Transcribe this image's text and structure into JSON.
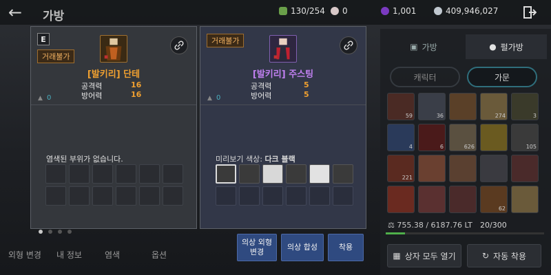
{
  "window": {
    "title": "가방"
  },
  "currencies": [
    {
      "icon": "inventory-capacity-icon",
      "value": "130/254",
      "color": "#6aa04a"
    },
    {
      "icon": "pearl-icon",
      "value": "0",
      "color": "#d8c8c8"
    },
    {
      "icon": "purple-gem-icon",
      "value": "1,001",
      "color": "#7a3ac0"
    },
    {
      "icon": "silver-coin-icon",
      "value": "409,946,027",
      "color": "#c0c8d0"
    }
  ],
  "right_panel": {
    "tabs": [
      {
        "label": "가방",
        "active": false
      },
      {
        "label": "펄가방",
        "active": true
      }
    ],
    "subtabs": [
      {
        "label": "캐릭터",
        "active": false
      },
      {
        "label": "가문",
        "active": true
      }
    ],
    "grid_counts": [
      "59",
      "36",
      "",
      "274",
      "3",
      "4",
      "6",
      "626",
      "",
      "105",
      "221",
      "",
      "",
      "",
      "",
      "",
      "",
      "",
      "62",
      ""
    ],
    "weight": "755.38 / 6187.76 LT",
    "weight_fraction": 0.12,
    "slots": "20/300",
    "open_all_button": "상자 모두 열기",
    "auto_arrange_button": "자동 착용"
  },
  "bottom_tabs": [
    "외형 변경",
    "내 정보",
    "염색",
    "옵션"
  ],
  "left_item": {
    "grade": "E",
    "trade_tag": "거래불가",
    "name": "[발키리] 단테",
    "stats": [
      {
        "label": "공격력",
        "value": "16"
      },
      {
        "label": "방어력",
        "value": "16"
      }
    ],
    "weight": "0",
    "dye_message": "염색된 부위가 없습니다.",
    "name_color": "#f0a030"
  },
  "right_item": {
    "trade_tag": "거래불가",
    "name": "[발키리] 주스팅",
    "stats": [
      {
        "label": "공격력",
        "value": "5"
      },
      {
        "label": "방어력",
        "value": "5"
      }
    ],
    "weight": "0",
    "preview_label": "미리보기 색상:",
    "preview_color_name": "다크 블랙",
    "swatches": [
      "#3a3a3a",
      "#3a3a3a",
      "#d8d8d8",
      "#3a3a3a",
      "#e2e2e2",
      "#3a3a3a"
    ],
    "name_color": "#c080f0"
  },
  "actions": {
    "appearance_change": "의상 외형 변경",
    "synthesis": "의상 합성",
    "equip": "착용"
  }
}
